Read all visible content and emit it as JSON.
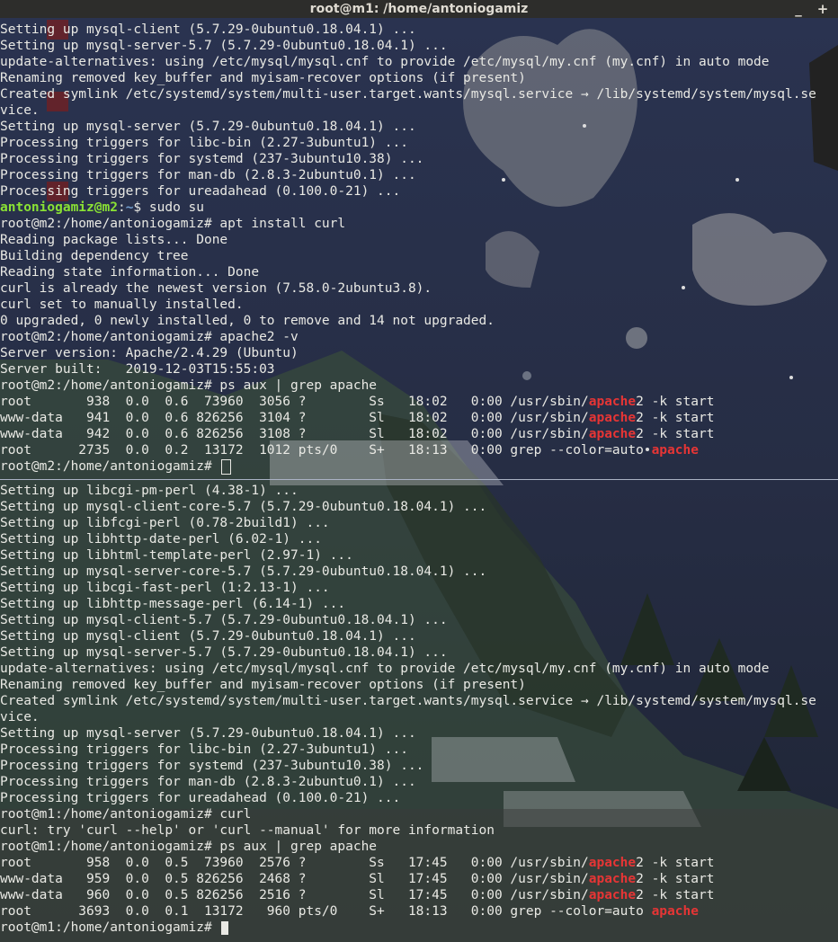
{
  "window": {
    "title": "root@m1: /home/antoniogamiz",
    "minimize_glyph": "_",
    "maximize_glyph": "+"
  },
  "colors": {
    "text": "#e9e9e4",
    "highlight": "#e63535",
    "user_prompt": "#8ae234",
    "path_prompt": "#729fcf",
    "titlebar": "#2d2d2b"
  },
  "top_pane": {
    "lines": [
      {
        "segments": [
          {
            "t": "Setting up mysql-client (5.7.29-0ubuntu0.18.04.1) ..."
          }
        ]
      },
      {
        "segments": [
          {
            "t": "Setting up mysql-server-5.7 (5.7.29-0ubuntu0.18.04.1) ..."
          }
        ]
      },
      {
        "segments": [
          {
            "t": "update-alternatives: using /etc/mysql/mysql.cnf to provide /etc/mysql/my.cnf (my.cnf) in auto mode"
          }
        ]
      },
      {
        "segments": [
          {
            "t": "Renaming removed key_buffer and myisam-recover options (if present)"
          }
        ]
      },
      {
        "segments": [
          {
            "t": "Created symlink /etc/systemd/system/multi-user.target.wants/mysql.service → /lib/systemd/system/mysql.se"
          }
        ]
      },
      {
        "segments": [
          {
            "t": "vice."
          }
        ]
      },
      {
        "segments": [
          {
            "t": "Setting up mysql-server (5.7.29-0ubuntu0.18.04.1) ..."
          }
        ]
      },
      {
        "segments": [
          {
            "t": "Processing triggers for libc-bin (2.27-3ubuntu1) ..."
          }
        ]
      },
      {
        "segments": [
          {
            "t": "Processing triggers for systemd (237-3ubuntu10.38) ..."
          }
        ]
      },
      {
        "segments": [
          {
            "t": "Processing triggers for man-db (2.8.3-2ubuntu0.1) ..."
          }
        ]
      },
      {
        "segments": [
          {
            "t": "Processing triggers for ureadahead (0.100.0-21) ..."
          }
        ]
      },
      {
        "segments": [
          {
            "t": "antoniogamiz@m2",
            "c": "user"
          },
          {
            "t": ":"
          },
          {
            "t": "~",
            "c": "path"
          },
          {
            "t": "$ sudo su"
          }
        ]
      },
      {
        "segments": [
          {
            "t": "root@m2:/home/antoniogamiz# apt install curl"
          }
        ]
      },
      {
        "segments": [
          {
            "t": "Reading package lists... Done"
          }
        ]
      },
      {
        "segments": [
          {
            "t": "Building dependency tree"
          }
        ]
      },
      {
        "segments": [
          {
            "t": "Reading state information... Done"
          }
        ]
      },
      {
        "segments": [
          {
            "t": "curl is already the newest version (7.58.0-2ubuntu3.8)."
          }
        ]
      },
      {
        "segments": [
          {
            "t": "curl set to manually installed."
          }
        ]
      },
      {
        "segments": [
          {
            "t": "0 upgraded, 0 newly installed, 0 to remove and 14 not upgraded."
          }
        ]
      },
      {
        "segments": [
          {
            "t": "root@m2:/home/antoniogamiz# apache2 -v"
          }
        ]
      },
      {
        "segments": [
          {
            "t": "Server version: Apache/2.4.29 (Ubuntu)"
          }
        ]
      },
      {
        "segments": [
          {
            "t": "Server built:   2019-12-03T15:55:03"
          }
        ]
      },
      {
        "segments": [
          {
            "t": "root@m2:/home/antoniogamiz# ps aux | grep apache"
          }
        ]
      },
      {
        "segments": [
          {
            "t": "root       938  0.0  0.6  73960  3056 ?        Ss   18:02   0:00 /usr/sbin/"
          },
          {
            "t": "apache",
            "c": "hl"
          },
          {
            "t": "2 -k start"
          }
        ]
      },
      {
        "segments": [
          {
            "t": "www-data   941  0.0  0.6 826256  3104 ?        Sl   18:02   0:00 /usr/sbin/"
          },
          {
            "t": "apache",
            "c": "hl"
          },
          {
            "t": "2 -k start"
          }
        ]
      },
      {
        "segments": [
          {
            "t": "www-data   942  0.0  0.6 826256  3108 ?        Sl   18:02   0:00 /usr/sbin/"
          },
          {
            "t": "apache",
            "c": "hl"
          },
          {
            "t": "2 -k start"
          }
        ]
      },
      {
        "segments": [
          {
            "t": "root      2735  0.0  0.2  13172  1012 pts/0    S+   18:13   0:00 grep --color=auto "
          },
          {
            "t": "apache",
            "c": "hl"
          }
        ]
      },
      {
        "segments": [
          {
            "t": "root@m2:/home/antoniogamiz# "
          }
        ],
        "cursor": "box"
      }
    ]
  },
  "bottom_pane": {
    "lines": [
      {
        "segments": [
          {
            "t": "Setting up libcgi-pm-perl (4.38-1) ..."
          }
        ]
      },
      {
        "segments": [
          {
            "t": "Setting up mysql-client-core-5.7 (5.7.29-0ubuntu0.18.04.1) ..."
          }
        ]
      },
      {
        "segments": [
          {
            "t": "Setting up libfcgi-perl (0.78-2build1) ..."
          }
        ]
      },
      {
        "segments": [
          {
            "t": "Setting up libhttp-date-perl (6.02-1) ..."
          }
        ]
      },
      {
        "segments": [
          {
            "t": "Setting up libhtml-template-perl (2.97-1) ..."
          }
        ]
      },
      {
        "segments": [
          {
            "t": "Setting up mysql-server-core-5.7 (5.7.29-0ubuntu0.18.04.1) ..."
          }
        ]
      },
      {
        "segments": [
          {
            "t": "Setting up libcgi-fast-perl (1:2.13-1) ..."
          }
        ]
      },
      {
        "segments": [
          {
            "t": "Setting up libhttp-message-perl (6.14-1) ..."
          }
        ]
      },
      {
        "segments": [
          {
            "t": "Setting up mysql-client-5.7 (5.7.29-0ubuntu0.18.04.1) ..."
          }
        ]
      },
      {
        "segments": [
          {
            "t": "Setting up mysql-client (5.7.29-0ubuntu0.18.04.1) ..."
          }
        ]
      },
      {
        "segments": [
          {
            "t": "Setting up mysql-server-5.7 (5.7.29-0ubuntu0.18.04.1) ..."
          }
        ]
      },
      {
        "segments": [
          {
            "t": "update-alternatives: using /etc/mysql/mysql.cnf to provide /etc/mysql/my.cnf (my.cnf) in auto mode"
          }
        ]
      },
      {
        "segments": [
          {
            "t": "Renaming removed key_buffer and myisam-recover options (if present)"
          }
        ]
      },
      {
        "segments": [
          {
            "t": "Created symlink /etc/systemd/system/multi-user.target.wants/mysql.service → /lib/systemd/system/mysql.se"
          }
        ]
      },
      {
        "segments": [
          {
            "t": "vice."
          }
        ]
      },
      {
        "segments": [
          {
            "t": "Setting up mysql-server (5.7.29-0ubuntu0.18.04.1) ..."
          }
        ]
      },
      {
        "segments": [
          {
            "t": "Processing triggers for libc-bin (2.27-3ubuntu1) ..."
          }
        ]
      },
      {
        "segments": [
          {
            "t": "Processing triggers for systemd (237-3ubuntu10.38) ..."
          }
        ]
      },
      {
        "segments": [
          {
            "t": "Processing triggers for man-db (2.8.3-2ubuntu0.1) ..."
          }
        ]
      },
      {
        "segments": [
          {
            "t": "Processing triggers for ureadahead (0.100.0-21) ..."
          }
        ]
      },
      {
        "segments": [
          {
            "t": "root@m1:/home/antoniogamiz# curl"
          }
        ]
      },
      {
        "segments": [
          {
            "t": "curl: try 'curl --help' or 'curl --manual' for more information"
          }
        ]
      },
      {
        "segments": [
          {
            "t": "root@m1:/home/antoniogamiz# ps aux | grep apache"
          }
        ]
      },
      {
        "segments": [
          {
            "t": "root       958  0.0  0.5  73960  2576 ?        Ss   17:45   0:00 /usr/sbin/"
          },
          {
            "t": "apache",
            "c": "hl"
          },
          {
            "t": "2 -k start"
          }
        ]
      },
      {
        "segments": [
          {
            "t": "www-data   959  0.0  0.5 826256  2468 ?        Sl   17:45   0:00 /usr/sbin/"
          },
          {
            "t": "apache",
            "c": "hl"
          },
          {
            "t": "2 -k start"
          }
        ]
      },
      {
        "segments": [
          {
            "t": "www-data   960  0.0  0.5 826256  2516 ?        Sl   17:45   0:00 /usr/sbin/"
          },
          {
            "t": "apache",
            "c": "hl"
          },
          {
            "t": "2 -k start"
          }
        ]
      },
      {
        "segments": [
          {
            "t": "root      3693  0.0  0.1  13172   960 pts/0    S+   18:13   0:00 grep --color=auto "
          },
          {
            "t": "apache",
            "c": "hl"
          }
        ]
      },
      {
        "segments": [
          {
            "t": "root@m1:/home/antoniogamiz# "
          }
        ],
        "cursor": "block"
      }
    ]
  }
}
